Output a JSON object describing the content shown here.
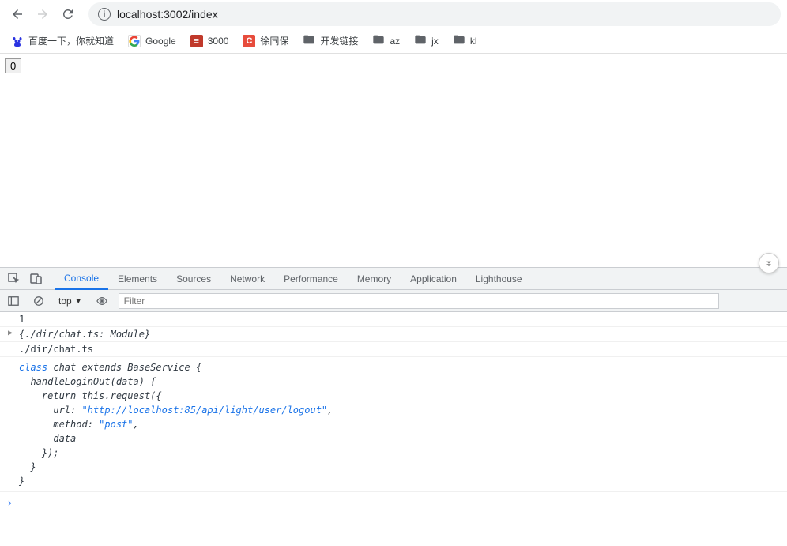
{
  "browser": {
    "url": "localhost:3002/index"
  },
  "bookmarks": [
    {
      "label": "百度一下，你就知道",
      "iconType": "baidu"
    },
    {
      "label": "Google",
      "iconType": "google"
    },
    {
      "label": "3000",
      "iconType": "num"
    },
    {
      "label": "徐同保",
      "iconType": "c"
    },
    {
      "label": "开发链接",
      "iconType": "folder"
    },
    {
      "label": "az",
      "iconType": "folder"
    },
    {
      "label": "jx",
      "iconType": "folder"
    },
    {
      "label": "kl",
      "iconType": "folder"
    }
  ],
  "page": {
    "buttonLabel": "0"
  },
  "devtools": {
    "tabs": [
      "Console",
      "Elements",
      "Sources",
      "Network",
      "Performance",
      "Memory",
      "Application",
      "Lighthouse"
    ],
    "activeTab": "Console",
    "contextLabel": "top",
    "filterPlaceholder": "Filter",
    "console": {
      "line1": "1",
      "moduleLine": "{./dir/chat.ts: Module}",
      "pathLine": "./dir/chat.ts",
      "code": {
        "l1_kw": "class",
        "l1_rest": " chat extends BaseService {",
        "l2": "  handleLoginOut(data) {",
        "l3": "    return this.request({",
        "l4_key": "      url: ",
        "l4_val": "\"http://localhost:85/api/light/user/logout\"",
        "l4_end": ",",
        "l5_key": "      method: ",
        "l5_val": "\"post\"",
        "l5_end": ",",
        "l6": "      data",
        "l7": "    });",
        "l8": "  }",
        "l9": "}"
      },
      "promptSymbol": "›"
    }
  }
}
